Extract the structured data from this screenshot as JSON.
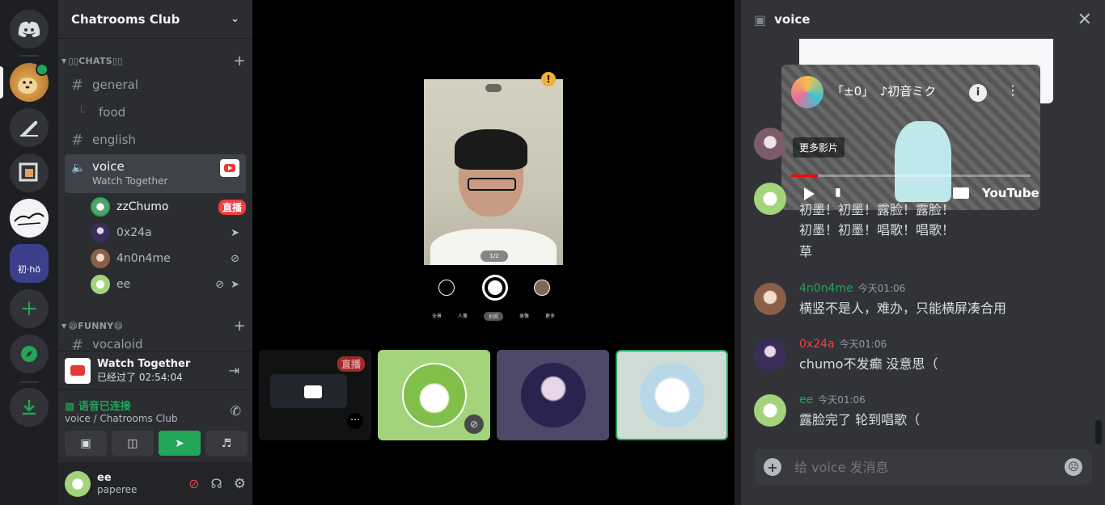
{
  "server": {
    "name": "Chatrooms Club",
    "icons": [
      "discord-home",
      "doge-server",
      "feather-server",
      "square-server",
      "dove-server",
      "anime-server"
    ],
    "anime_server_text": "初·hö"
  },
  "categories": [
    {
      "name": "▯▯CHATS▯▯"
    },
    {
      "name": "😄FUNNY😄"
    }
  ],
  "channels": {
    "general": "general",
    "food": "food",
    "english": "english",
    "voice": "voice",
    "voice_sub": "Watch Together",
    "vocaloid": "vocaloid"
  },
  "voice_users": [
    {
      "name": "zzChumo",
      "badge": "直播"
    },
    {
      "name": "0x24a"
    },
    {
      "name": "4n0n4me"
    },
    {
      "name": "ee"
    }
  ],
  "activity": {
    "title": "Watch Together",
    "elapsed": "已经过了 02:54:04"
  },
  "voice_status": {
    "status": "语音已连接",
    "location": "voice / Chatrooms Club",
    "status_color": "#23a55a"
  },
  "user": {
    "name": "ee",
    "tag": "paperee"
  },
  "stage": {
    "live_badge": "直播",
    "camera_modes": [
      "全景",
      "人像",
      "拍照",
      "录像",
      "更多"
    ],
    "zoom_label": "1/2"
  },
  "chat": {
    "channel": "voice",
    "youtube": {
      "title": "「±0」　♪初音ミク",
      "more": "更多影片",
      "brand": "YouTube"
    },
    "messages": [
      {
        "author": "",
        "time": "",
        "lines": [
          "初墨！初墨！露脸！露脸！",
          "初墨！初墨！唱歌！唱歌！",
          "草"
        ],
        "color": "#23a55a"
      },
      {
        "author": "4n0n4me",
        "time": "今天01:06",
        "lines": [
          "横竖不是人，难办，只能横屏凑合用"
        ],
        "color": "#23a55a"
      },
      {
        "author": "0x24a",
        "time": "今天01:06",
        "lines": [
          "chumo不发癫 没意思（"
        ],
        "color": "#f23f43"
      },
      {
        "author": "ee",
        "time": "今天01:06",
        "lines": [
          "露脸完了 轮到唱歌（"
        ],
        "color": "#23a55a"
      }
    ],
    "placeholder": "给 voice 发消息"
  }
}
